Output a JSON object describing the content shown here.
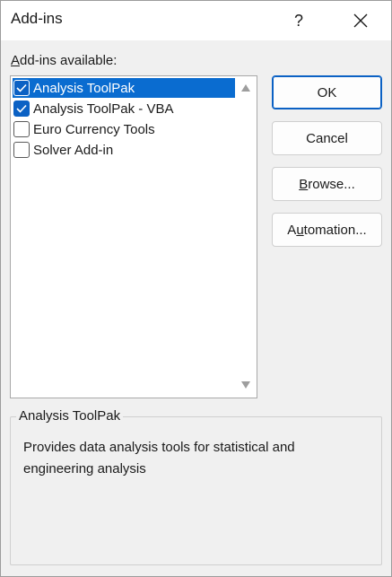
{
  "dialog": {
    "title": "Add-ins",
    "help_glyph": "?",
    "close_glyph": "✕"
  },
  "addins": {
    "label_accesskey": "A",
    "label_rest": "dd-ins available:",
    "items": [
      {
        "label": "Analysis ToolPak",
        "checked": true,
        "selected": true
      },
      {
        "label": "Analysis ToolPak - VBA",
        "checked": true,
        "selected": false
      },
      {
        "label": "Euro Currency Tools",
        "checked": false,
        "selected": false
      },
      {
        "label": "Solver Add-in",
        "checked": false,
        "selected": false
      }
    ]
  },
  "buttons": {
    "ok": "OK",
    "cancel": "Cancel",
    "browse_accesskey": "B",
    "browse_rest": "rowse...",
    "automation_pre": "A",
    "automation_accesskey": "u",
    "automation_rest": "tomation..."
  },
  "description": {
    "title": "Analysis ToolPak",
    "text": "Provides data analysis tools for statistical and engineering analysis"
  },
  "colors": {
    "accent": "#0b61c4",
    "selection": "#0a6cd0",
    "dialog_bg": "#f0f0f0"
  },
  "icons": {
    "check": "checkmark-icon",
    "close": "close-icon",
    "scroll_up": "scroll-up-arrow-icon",
    "scroll_down": "scroll-down-arrow-icon"
  }
}
